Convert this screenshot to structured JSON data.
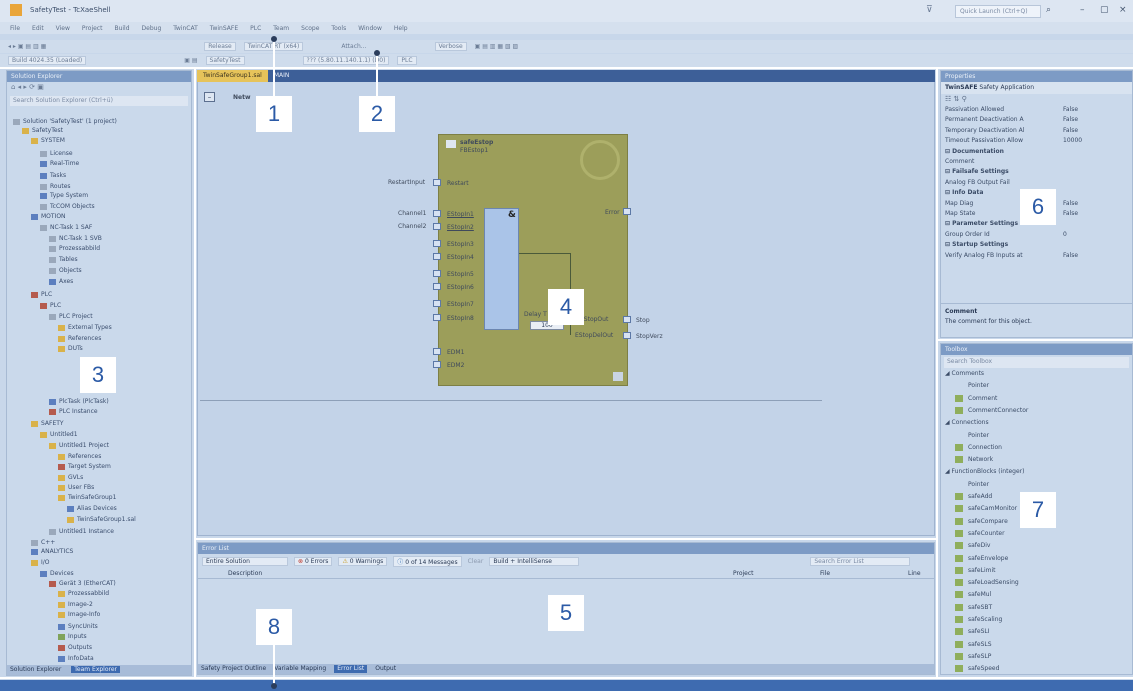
{
  "window": {
    "title": "SafetyTest - TcXaeShell",
    "quick_launch": "Quick Launch (Ctrl+Q)"
  },
  "menu": [
    "File",
    "Edit",
    "View",
    "Project",
    "Build",
    "Debug",
    "TwinCAT",
    "TwinSAFE",
    "PLC",
    "Team",
    "Scope",
    "Tools",
    "Window",
    "Help"
  ],
  "toolbar": {
    "config": "Release",
    "platform": "TwinCAT RT (x64)",
    "attach": "Attach...",
    "verbose": "Verbose",
    "build": "Build 4024.35 (Loaded)",
    "target": "SafetyTest",
    "address": "??? (5.80.11.140.1.1) (D0)",
    "plc": "PLC"
  },
  "solution_explorer": {
    "title": "Solution Explorer",
    "search": "Search Solution Explorer (Ctrl+ü)",
    "items": [
      "Solution 'SafetyTest' (1 project)",
      "SafetyTest",
      "SYSTEM",
      "License",
      "Real-Time",
      "Tasks",
      "Routes",
      "Type System",
      "TcCOM Objects",
      "MOTION",
      "NC-Task 1 SAF",
      "NC-Task 1 SVB",
      "Prozessabbild",
      "Tables",
      "Objects",
      "Axes",
      "PLC",
      "PLC",
      "PLC Project",
      "External Types",
      "References",
      "DUTs",
      "PlcTask (PlcTask)",
      "PLC Instance",
      "SAFETY",
      "Untitled1",
      "Untitled1 Project",
      "References",
      "Target System",
      "GVLs",
      "User FBs",
      "TwinSafeGroup1",
      "Alias Devices",
      "TwinSafeGroup1.sal",
      "Untitled1 Instance",
      "C++",
      "ANALYTICS",
      "I/O",
      "Devices",
      "Gerät 3 (EtherCAT)",
      "Prozessabbild",
      "Image-2",
      "Image-Info",
      "SyncUnits",
      "Inputs",
      "Outputs",
      "InfoData"
    ],
    "bottom_tabs": [
      "Solution Explorer",
      "Team Explorer"
    ]
  },
  "editor": {
    "tabs": [
      "TwinSafeGroup1.sal",
      "MAIN"
    ],
    "network_label": "Netw",
    "fb": {
      "type": "safeEstop",
      "name": "FBEstop1",
      "and_symbol": "&",
      "inputs_left": [
        "RestartInput",
        "Channel1",
        "Channel2"
      ],
      "pins": [
        "Restart",
        "EStopIn1",
        "EStopIn2",
        "EStopIn3",
        "EStopIn4",
        "EStopIn5",
        "EStopIn6",
        "EStopIn7",
        "EStopIn8",
        "EDM1",
        "EDM2"
      ],
      "error": "Error",
      "delay_label": "Delay T",
      "delay_value": "100",
      "outputs": [
        "EStopOut",
        "EStopDelOut"
      ],
      "out_vars": [
        "Stop",
        "StopVerz"
      ]
    }
  },
  "properties": {
    "title": "Properties",
    "object": "TwinSAFE",
    "object_kind": "Safety Application",
    "rows": [
      {
        "name": "Passivation Allowed",
        "value": "False",
        "section": false
      },
      {
        "name": "Permanent Deactivation A",
        "value": "False",
        "section": false
      },
      {
        "name": "Temporary Deactivation Al",
        "value": "False",
        "section": false
      },
      {
        "name": "Timeout Passivation Allow",
        "value": "10000",
        "section": false
      },
      {
        "name": "Documentation",
        "value": "",
        "section": true
      },
      {
        "name": "Comment",
        "value": "",
        "section": false
      },
      {
        "name": "Failsafe Settings",
        "value": "",
        "section": true
      },
      {
        "name": "Analog FB Output Fail",
        "value": "",
        "section": false
      },
      {
        "name": "Info Data",
        "value": "",
        "section": true
      },
      {
        "name": "Map Diag",
        "value": "False",
        "section": false
      },
      {
        "name": "Map State",
        "value": "False",
        "section": false
      },
      {
        "name": "Parameter Settings",
        "value": "",
        "section": true
      },
      {
        "name": "Group Order Id",
        "value": "0",
        "section": false
      },
      {
        "name": "Startup Settings",
        "value": "",
        "section": true
      },
      {
        "name": "Verify Analog FB Inputs at",
        "value": "False",
        "section": false
      }
    ],
    "desc_title": "Comment",
    "desc_text": "The comment for this object."
  },
  "toolbox": {
    "title": "Toolbox",
    "search": "Search Toolbox",
    "items": [
      {
        "label": "Comments",
        "header": true
      },
      {
        "label": "Pointer",
        "header": false
      },
      {
        "label": "Comment",
        "header": false
      },
      {
        "label": "CommentConnector",
        "header": false
      },
      {
        "label": "Connections",
        "header": true
      },
      {
        "label": "Pointer",
        "header": false
      },
      {
        "label": "Connection",
        "header": false
      },
      {
        "label": "Network",
        "header": false
      },
      {
        "label": "FunctionBlocks (integer)",
        "header": true
      },
      {
        "label": "Pointer",
        "header": false
      },
      {
        "label": "safeAdd",
        "header": false
      },
      {
        "label": "safeCamMonitor",
        "header": false
      },
      {
        "label": "safeCompare",
        "header": false
      },
      {
        "label": "safeCounter",
        "header": false
      },
      {
        "label": "safeDiv",
        "header": false
      },
      {
        "label": "safeEnvelope",
        "header": false
      },
      {
        "label": "safeLimit",
        "header": false
      },
      {
        "label": "safeLoadSensing",
        "header": false
      },
      {
        "label": "safeMul",
        "header": false
      },
      {
        "label": "safeSBT",
        "header": false
      },
      {
        "label": "safeScaling",
        "header": false
      },
      {
        "label": "safeSLI",
        "header": false
      },
      {
        "label": "safeSLS",
        "header": false
      },
      {
        "label": "safeSLP",
        "header": false
      },
      {
        "label": "safeSpeed",
        "header": false
      }
    ]
  },
  "error_list": {
    "title": "Error List",
    "scope": "Entire Solution",
    "errors": "0 Errors",
    "warnings": "0 Warnings",
    "messages": "0 of 14 Messages",
    "clear": "Clear",
    "filter": "Build + IntelliSense",
    "search": "Search Error List",
    "columns": [
      "Description",
      "Project",
      "File",
      "Line"
    ],
    "bottom_tabs": [
      "Safety Project Outline",
      "Variable Mapping",
      "Error List",
      "Output"
    ]
  },
  "callouts": [
    "1",
    "2",
    "3",
    "4",
    "5",
    "6",
    "7",
    "8"
  ]
}
